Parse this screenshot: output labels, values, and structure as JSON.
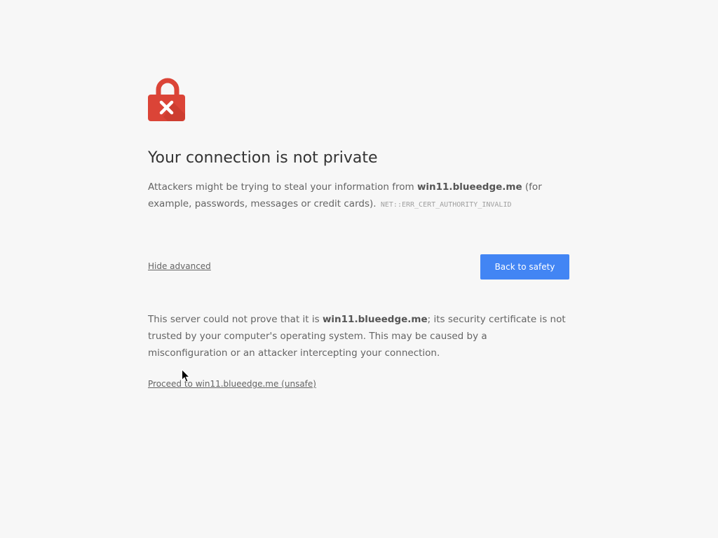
{
  "page": {
    "title": "Your connection is not private",
    "intro_prefix": "Attackers might be trying to steal your information from ",
    "host": "win11.blueedge.me",
    "intro_suffix": " (for example, passwords, messages or credit cards).",
    "error_code": "NET::ERR_CERT_AUTHORITY_INVALID"
  },
  "actions": {
    "hide_advanced_label": "Hide advanced",
    "back_label": "Back to safety"
  },
  "details": {
    "prefix": "This server could not prove that it is ",
    "host": "win11.blueedge.me",
    "suffix": "; its security certificate is not trusted by your computer's operating system. This may be caused by a misconfiguration or an attacker intercepting your connection.",
    "proceed_label": "Proceed to win11.blueedge.me (unsafe)"
  },
  "icons": {
    "lock": "lock-error-icon",
    "cursor": "mouse-cursor-icon"
  },
  "colors": {
    "background": "#f7f7f7",
    "lock_red": "#db4437",
    "button_blue": "#4285f4",
    "title_text": "#333333",
    "body_text": "#646464"
  }
}
